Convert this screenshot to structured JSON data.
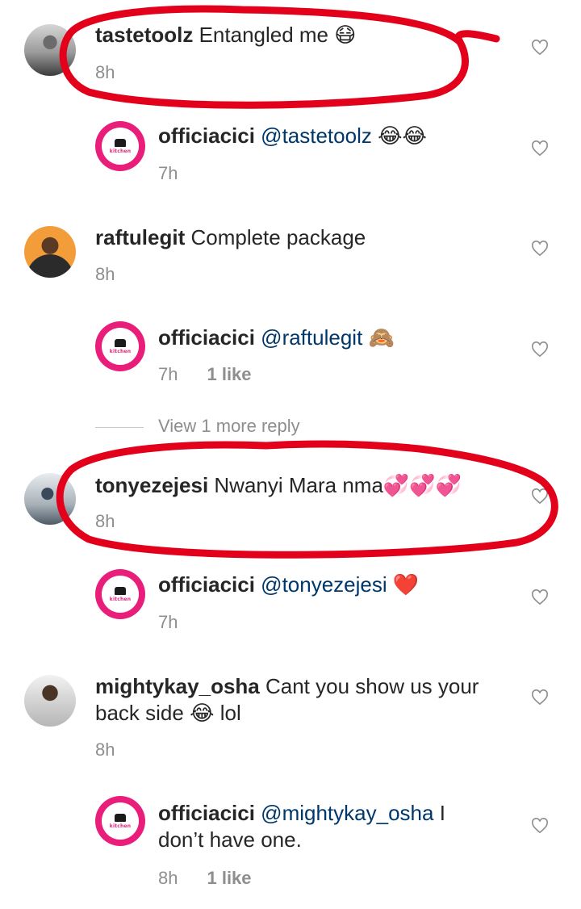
{
  "comments": [
    {
      "username": "tastetoolz",
      "text": "Entangled me",
      "emoji": "😷",
      "time": "8h",
      "reply": {
        "username": "officiacici",
        "mention": "@tastetoolz",
        "text": "",
        "emoji": "😂😂",
        "time": "7h",
        "likes": ""
      }
    },
    {
      "username": "raftulegit",
      "text": "Complete package",
      "emoji": "",
      "time": "8h",
      "reply": {
        "username": "officiacici",
        "mention": "@raftulegit",
        "text": "",
        "emoji": "🙈",
        "time": "7h",
        "likes": "1 like"
      },
      "view_more": "View 1 more reply"
    },
    {
      "username": "tonyezejesi",
      "text": "Nwanyi Mara nma",
      "emoji": "💞💞💞",
      "time": "8h",
      "reply": {
        "username": "officiacici",
        "mention": "@tonyezejesi",
        "text": "",
        "emoji": "❤️",
        "time": "7h",
        "likes": ""
      }
    },
    {
      "username": "mightykay_osha",
      "text_line1": "Cant you show us your",
      "text_line2": "back side",
      "emoji": "😂",
      "text_after_emoji": "lol",
      "time": "8h",
      "reply": {
        "username": "officiacici",
        "mention": "@mightykay_osha",
        "text_line1_rest": "I",
        "text_line2": "don’t have one.",
        "time": "8h",
        "likes": "1 like"
      }
    }
  ],
  "logo_text": "kitchen",
  "colors": {
    "mention": "#00376b",
    "meta": "#8e8e8e",
    "annotation": "#e3001b",
    "logo": "#e91e7a"
  }
}
